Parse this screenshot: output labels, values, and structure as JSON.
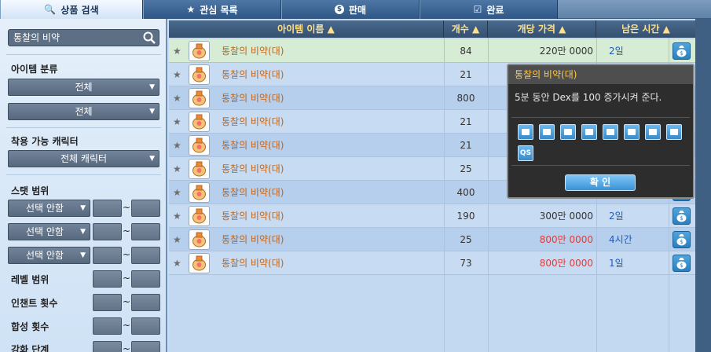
{
  "tabs": [
    {
      "label": "상품 검색",
      "icon": "search-icon"
    },
    {
      "label": "관심 목록",
      "icon": "star-icon"
    },
    {
      "label": "판매",
      "icon": "coin-icon"
    },
    {
      "label": "완료",
      "icon": "checkbox-icon"
    }
  ],
  "left": {
    "search_value": "통찰의 비약",
    "item_category_label": "아이템 분류",
    "category1": "전체",
    "category2": "전체",
    "equip_char_label": "착용 가능 캐릭터",
    "equip_char": "전체 캐릭터",
    "stat_range_label": "스탯 범위",
    "stat_select": "선택 안함",
    "level_range_label": "레벨 범위",
    "enchant_label": "인챈트 횟수",
    "synth_label": "합성 횟수",
    "enhance_label": "강화 단계",
    "tilde": "~"
  },
  "table": {
    "headers": {
      "name": "아이템 이름 ▲",
      "qty": "개수 ▲",
      "price": "개당 가격 ▲",
      "time": "남은 시간 ▲"
    },
    "rows": [
      {
        "name": "통찰의 비약(대)",
        "qty": "84",
        "price": "220만 0000",
        "price_red": false,
        "time": "2일"
      },
      {
        "name": "통찰의 비약(대)",
        "qty": "21",
        "price": "",
        "price_red": false,
        "time": ""
      },
      {
        "name": "통찰의 비약(대)",
        "qty": "800",
        "price": "",
        "price_red": false,
        "time": ""
      },
      {
        "name": "통찰의 비약(대)",
        "qty": "21",
        "price": "",
        "price_red": false,
        "time": ""
      },
      {
        "name": "통찰의 비약(대)",
        "qty": "21",
        "price": "",
        "price_red": false,
        "time": ""
      },
      {
        "name": "통찰의 비약(대)",
        "qty": "25",
        "price": "",
        "price_red": false,
        "time": ""
      },
      {
        "name": "통찰의 비약(대)",
        "qty": "400",
        "price": "",
        "price_red": false,
        "time": ""
      },
      {
        "name": "통찰의 비약(대)",
        "qty": "190",
        "price": "300만 0000",
        "price_red": false,
        "time": "2일"
      },
      {
        "name": "통찰의 비약(대)",
        "qty": "25",
        "price": "800만 0000",
        "price_red": true,
        "time": "4시간"
      },
      {
        "name": "통찰의 비약(대)",
        "qty": "73",
        "price": "800만 0000",
        "price_red": true,
        "time": "1일"
      }
    ]
  },
  "tooltip": {
    "title": "통찰의 비약(대)",
    "desc": "5분 동안 Dex를 100 증가시켜 준다.",
    "icons": [
      "trade-icon",
      "drop-icon",
      "scale-icon",
      "money-icon",
      "box-icon",
      "box-open-icon",
      "repair-icon",
      "shop-icon",
      "QS"
    ],
    "confirm": "확 인"
  },
  "colors": {
    "tab_active": "#e9f2fb",
    "item_name": "#c0651a",
    "price_red": "#e13b3b",
    "time_blue": "#2259b8",
    "tooltip_title": "#ffc94a"
  }
}
